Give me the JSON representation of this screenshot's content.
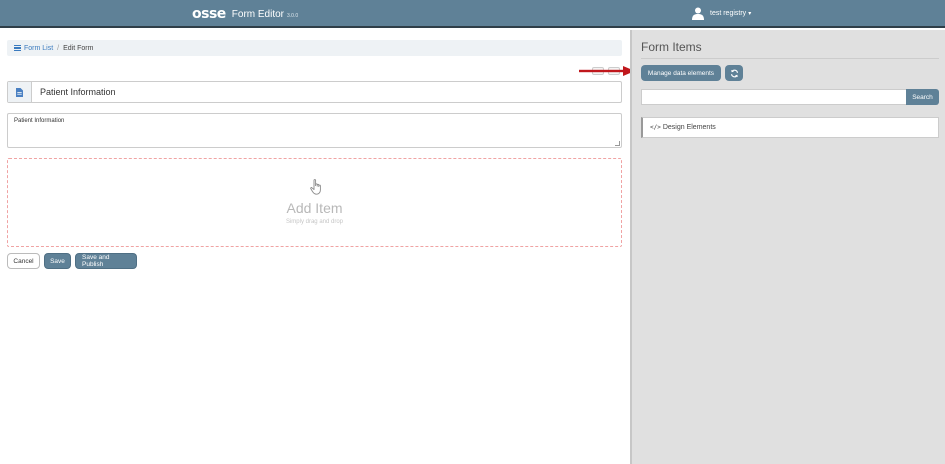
{
  "header": {
    "logo": "osse",
    "app_title": "Form Editor",
    "version": "3.0.0",
    "user_name": "test registry",
    "user_caret": "▾"
  },
  "breadcrumb": {
    "form_list": "Form List",
    "separator": "/",
    "current": "Edit Form"
  },
  "form": {
    "title_value": "Patient Information",
    "description_value": "Patient Information"
  },
  "dropzone": {
    "title": "Add Item",
    "subtitle": "Simply drag and drop"
  },
  "actions": {
    "cancel": "Cancel",
    "save": "Save",
    "save_publish": "Save and Publish"
  },
  "panel": {
    "title": "Form Items",
    "manage_label": "Manage data elements",
    "search_value": "",
    "search_label": "Search",
    "design_elements": "Design Elements",
    "design_code_glyph": "</>"
  },
  "colors": {
    "primary": "#5f8197",
    "arrow": "#c0171c",
    "panel_bg": "#e0e0e0",
    "link": "#3b7bbf"
  },
  "icons": {
    "user": "user-icon",
    "list": "list-icon",
    "document": "document-icon",
    "hand": "pointer-hand-icon",
    "refresh": "refresh-icon",
    "code": "code-icon"
  }
}
